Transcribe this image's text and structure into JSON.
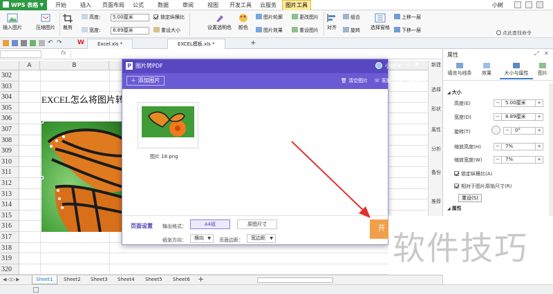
{
  "app": {
    "name": "WPS 表格",
    "user": "小树"
  },
  "menu": [
    "开始",
    "插入",
    "页面布局",
    "公式",
    "数据",
    "审阅",
    "视图",
    "开发工具",
    "云服务",
    "图片工具"
  ],
  "ribbon": {
    "insert_picture": "插入图片",
    "compress_picture": "压缩图片",
    "crop": "裁剪",
    "height_label": "高度:",
    "height_value": "5.00厘米",
    "width_label": "宽度:",
    "width_value": "8.89厘米",
    "lock_ratio": "锁定纵横比",
    "reset_size": "重设大小",
    "set_transparent": "设置透明色",
    "color": "颜色",
    "picture_outline": "图片轮廓",
    "picture_effect": "图片效果",
    "change_picture": "更改图片",
    "reset_picture": "重设图片",
    "align": "对齐",
    "rotate": "旋转",
    "group": "组合",
    "selection_pane": "选择窗格",
    "bring_forward": "上移一层",
    "send_backward": "下移一层"
  },
  "file_tabs": [
    {
      "name": "Excel.xls *",
      "active": false
    },
    {
      "name": "EXCEL模板.xls *",
      "active": true
    }
  ],
  "formula_bar": {
    "fx": "fx"
  },
  "columns": [
    "A",
    "B"
  ],
  "rows": [
    "302",
    "303",
    "304",
    "305",
    "306",
    "307",
    "308",
    "309",
    "310",
    "311",
    "312",
    "313",
    "314",
    "315",
    "316",
    "317",
    "318",
    "319",
    "320"
  ],
  "cell_text": "EXCEL怎么将图片转",
  "sheets": [
    "Sheet1",
    "Sheet2",
    "Sheet3",
    "Sheet4",
    "Sheet5",
    "Sheet6"
  ],
  "dialog": {
    "title": "图片转PDF",
    "user": "小树",
    "add_picture": "添加图片",
    "clear_pictures": "清空图片",
    "support": "客服",
    "vip": "开通会员",
    "file_name": "图片 18.png",
    "page_settings": "页面设置",
    "output_format_label": "输出格式：",
    "format_a4": "A4纸",
    "format_original": "原图尺寸",
    "orientation_label": "纸张方向：",
    "orientation_value": "横向",
    "margin_label": "页面边距：",
    "margin_value": "宽边距",
    "start_button": "开"
  },
  "side_strip": [
    "新建",
    "选择",
    "形状",
    "属性",
    "分析",
    "备份",
    "推荐"
  ],
  "panel": {
    "title": "属性",
    "tabs": [
      "填充与线条",
      "效果",
      "大小与属性",
      "图片"
    ],
    "section_size": "大小",
    "height_label": "高度(E)",
    "height_value": "5.00厘米",
    "width_label": "宽度(D)",
    "width_value": "8.89厘米",
    "rotate_label": "旋转(T)",
    "rotate_value": "0°",
    "scale_h_label": "缩放高度(H)",
    "scale_h_value": "7%",
    "scale_w_label": "缩放宽度(W)",
    "scale_w_value": "7%",
    "lock_ratio": "锁定纵横比(A)",
    "relative": "相对于图片原始尺寸(R)",
    "reset": "重设(S)",
    "section_props": "属性",
    "hint": "点此查找命令"
  },
  "watermark": "软件技巧",
  "colors": {
    "wps_green": "#2e9a43",
    "dialog_purple": "#5747c1",
    "start_orange": "#f0a04b",
    "arrow_red": "#e0322b"
  }
}
